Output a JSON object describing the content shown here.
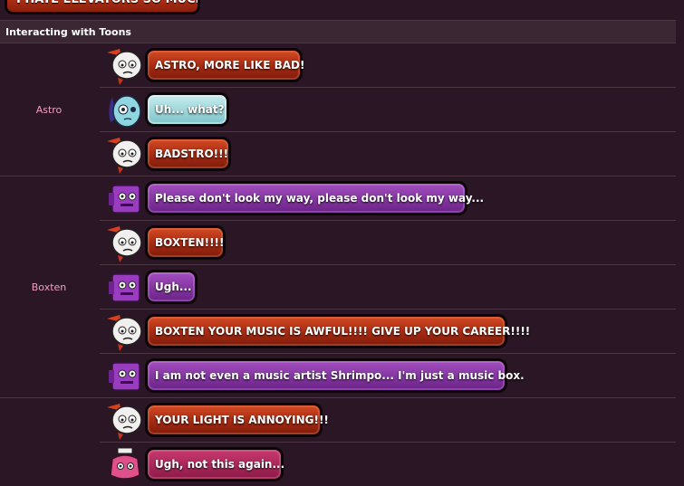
{
  "top_partial": {
    "text": "I HATE ELEVATORS SO MUCH..."
  },
  "section": {
    "title": "Interacting with Toons"
  },
  "groups": [
    {
      "label": "Astro"
    },
    {
      "label": "Boxten"
    }
  ],
  "rows": [
    {
      "speaker": "Shrimpo",
      "text": "ASTRO, MORE LIKE BAD!",
      "bubble_color": "#b23216"
    },
    {
      "speaker": "Astro",
      "text": "Uh... what?",
      "bubble_color": "#9fd8dc"
    },
    {
      "speaker": "Shrimpo",
      "text": "BADSTRO!!!",
      "bubble_color": "#b23216"
    },
    {
      "speaker": "Boxten",
      "text": "Please don't look my way, please don't look my way...",
      "bubble_color": "#8a36a6"
    },
    {
      "speaker": "Shrimpo",
      "text": "BOXTEN!!!!",
      "bubble_color": "#b23216"
    },
    {
      "speaker": "Boxten",
      "text": "Ugh...",
      "bubble_color": "#8a36a6"
    },
    {
      "speaker": "Shrimpo",
      "text": "BOXTEN YOUR MUSIC IS AWFUL!!!! GIVE UP YOUR CAREER!!!!",
      "bubble_color": "#b23216"
    },
    {
      "speaker": "Boxten",
      "text": "I am not even a music artist Shrimpo... I'm just a music box.",
      "bubble_color": "#8a36a6"
    },
    {
      "speaker": "Shrimpo",
      "text": "YOUR LIGHT IS ANNOYING!!!",
      "bubble_color": "#b23216"
    },
    {
      "speaker": "Cosmo",
      "text": "Ugh, not this again...",
      "bubble_color": "#a8285c"
    }
  ],
  "colors": {
    "background": "#2a1625",
    "header_bg": "#3a2733",
    "group_label": "#f29ec6",
    "separator": "#4d3743"
  }
}
